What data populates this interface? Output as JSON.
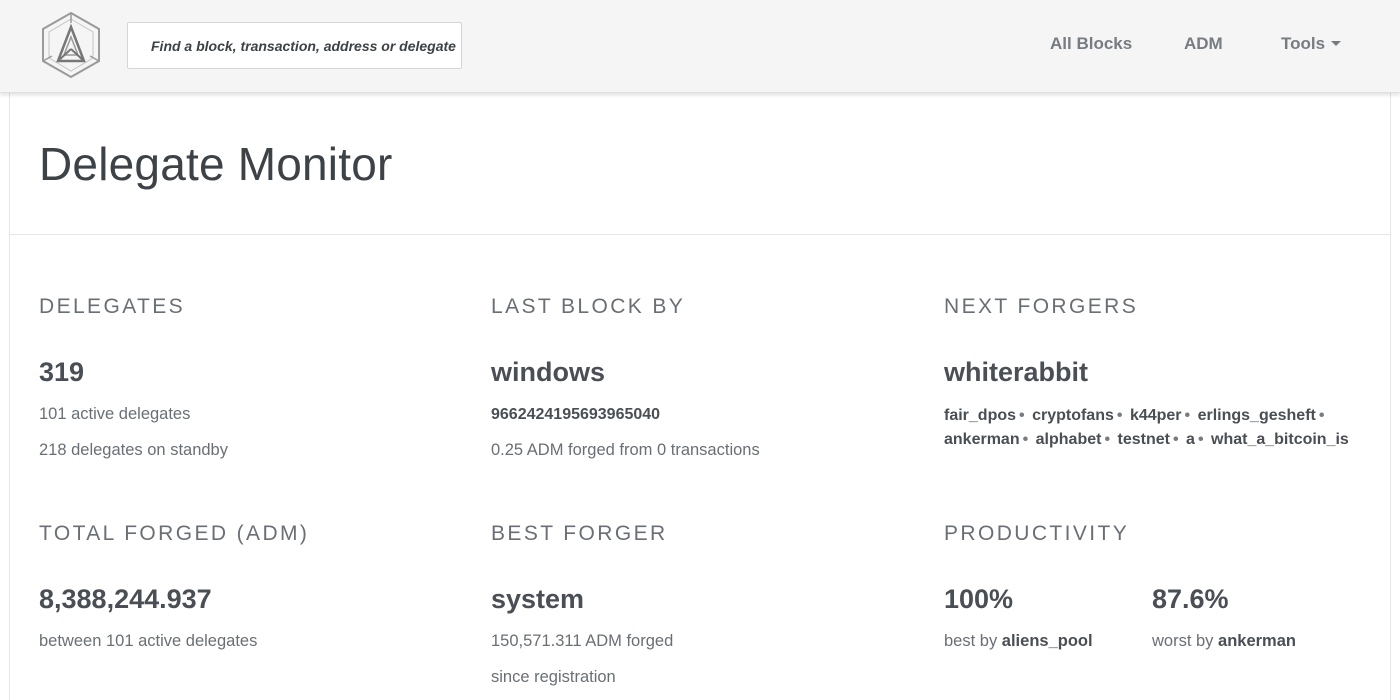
{
  "header": {
    "search_placeholder": "Find a block, transaction, address or delegate",
    "nav": {
      "all_blocks": "All Blocks",
      "adm": "ADM",
      "tools": "Tools"
    }
  },
  "page": {
    "title": "Delegate Monitor"
  },
  "delegates": {
    "title": "DELEGATES",
    "count": "319",
    "active": "101 active delegates",
    "standby": "218 delegates on standby"
  },
  "last_block": {
    "title": "LAST BLOCK BY",
    "delegate": "windows",
    "block_id": "9662424195693965040",
    "details": "0.25 ADM forged from 0 transactions"
  },
  "next_forgers": {
    "title": "NEXT FORGERS",
    "current": "whiterabbit",
    "list": [
      "fair_dpos",
      "cryptofans",
      "k44per",
      "erlings_gesheft",
      "ankerman",
      "alphabet",
      "testnet",
      "a",
      "what_a_bitcoin_is"
    ]
  },
  "total_forged": {
    "title": "TOTAL FORGED (ADM)",
    "amount": "8,388,244.937",
    "note": "between 101 active delegates"
  },
  "best_forger": {
    "title": "BEST FORGER",
    "delegate": "system",
    "amount": "150,571.311 ADM forged",
    "note": "since registration"
  },
  "productivity": {
    "title": "PRODUCTIVITY",
    "best_value": "100%",
    "best_prefix": "best by",
    "best_delegate": "aliens_pool",
    "worst_value": "87.6%",
    "worst_prefix": "worst by",
    "worst_delegate": "ankerman"
  },
  "colors": {
    "navbar_bg": "#f5f5f5",
    "text_dark": "#4a4f55",
    "text_muted": "#6a6f75"
  }
}
